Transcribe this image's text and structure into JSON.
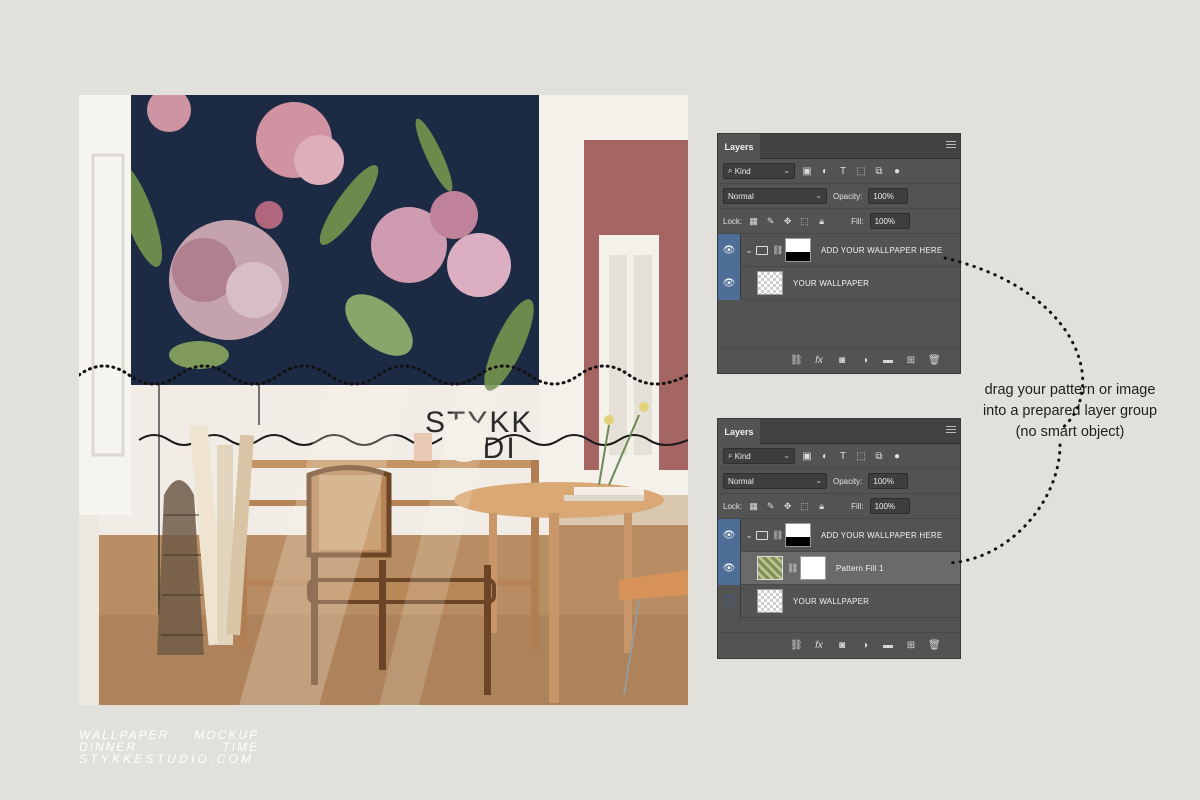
{
  "brand": {
    "line1_left": "WALLPAPER",
    "line1_right": "MOCKUP",
    "line2_left": "DINNER",
    "line2_right": "TIME",
    "line3": "STYKKESTUDIO.COM"
  },
  "mockup": {
    "wall_text_line1": "STYKK",
    "wall_text_line2": "UDI"
  },
  "annotation": {
    "line1": "drag your pattern or image",
    "line2": "into a prepared layer group",
    "line3": "(no smart object)"
  },
  "panel1": {
    "tab": "Layers",
    "filter_kind": "Kind",
    "blend_mode": "Normal",
    "opacity_label": "Opacity:",
    "opacity_value": "100%",
    "lock_label": "Lock:",
    "fill_label": "Fill:",
    "fill_value": "100%",
    "layers": [
      {
        "name": "ADD YOUR WALLPAPER HERE",
        "visible": true
      },
      {
        "name": "YOUR WALLPAPER",
        "visible": true
      }
    ]
  },
  "panel2": {
    "tab": "Layers",
    "filter_kind": "Kind",
    "blend_mode": "Normal",
    "opacity_label": "Opacity:",
    "opacity_value": "100%",
    "lock_label": "Lock:",
    "fill_label": "Fill:",
    "fill_value": "100%",
    "layers": [
      {
        "name": "ADD YOUR WALLPAPER HERE",
        "visible": true
      },
      {
        "name": "Pattern Fill 1",
        "visible": true,
        "selected": true
      },
      {
        "name": "YOUR WALLPAPER",
        "visible": false
      }
    ]
  },
  "icons": {
    "filter": [
      "image-filter-icon",
      "adjustment-filter-icon",
      "type-filter-icon",
      "shape-filter-icon",
      "smart-object-filter-icon"
    ],
    "lock": [
      "lock-transparent-icon",
      "lock-image-icon",
      "lock-position-icon",
      "lock-artboard-icon",
      "lock-all-icon"
    ],
    "footer": [
      "link-layers-icon",
      "fx-icon",
      "add-mask-icon",
      "adjustment-layer-icon",
      "new-group-icon",
      "new-layer-icon",
      "delete-layer-icon"
    ]
  },
  "colors": {
    "background": "#e2e0da",
    "panel": "#535353",
    "eye_column": "#4e6e98",
    "wallpaper_navy": "#1d2a44",
    "door_wall_rose": "#a56563"
  }
}
